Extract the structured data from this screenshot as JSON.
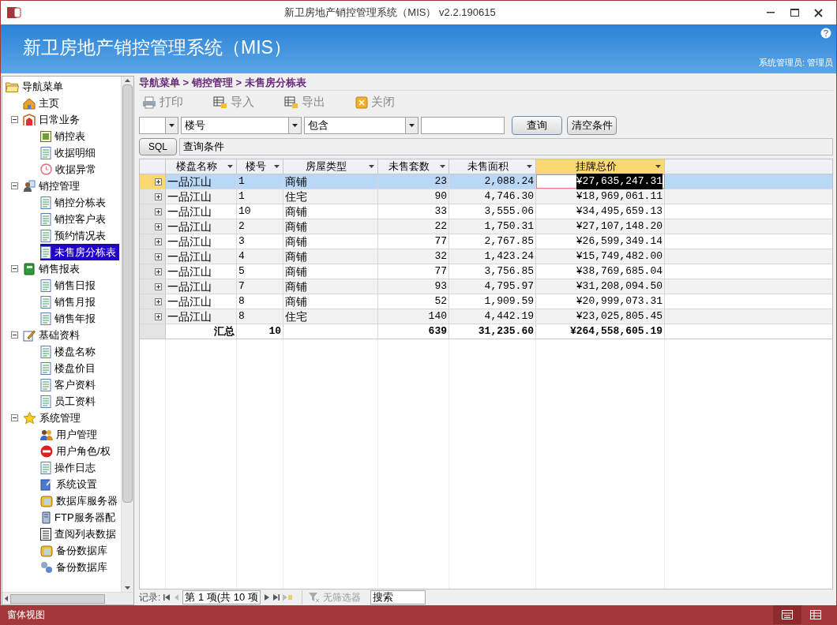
{
  "window": {
    "title": "新卫房地产销控管理系统（MIS） v2.2.190615"
  },
  "banner": {
    "title": "新卫房地产销控管理系统（MIS）",
    "user": "系统管理员: 管理员"
  },
  "nav": {
    "label": "导航菜单",
    "children": [
      {
        "label": "主页",
        "selected": false
      },
      {
        "label": "日常业务",
        "expanded": true,
        "selected": false,
        "children": [
          {
            "label": "销控表",
            "selected": false
          },
          {
            "label": "收据明细",
            "selected": false
          },
          {
            "label": "收据异常",
            "selected": false
          }
        ]
      },
      {
        "label": "销控管理",
        "expanded": true,
        "selected": false,
        "children": [
          {
            "label": "销控分栋表",
            "selected": false
          },
          {
            "label": "销控客户表",
            "selected": false
          },
          {
            "label": "预约情况表",
            "selected": false
          },
          {
            "label": "未售房分栋表",
            "selected": true
          }
        ]
      },
      {
        "label": "销售报表",
        "expanded": true,
        "selected": false,
        "children": [
          {
            "label": "销售日报",
            "selected": false
          },
          {
            "label": "销售月报",
            "selected": false
          },
          {
            "label": "销售年报",
            "selected": false
          }
        ]
      },
      {
        "label": "基础资料",
        "expanded": true,
        "selected": false,
        "children": [
          {
            "label": "楼盘名称",
            "selected": false
          },
          {
            "label": "楼盘价目",
            "selected": false
          },
          {
            "label": "客户资料",
            "selected": false
          },
          {
            "label": "员工资料",
            "selected": false
          }
        ]
      },
      {
        "label": "系统管理",
        "expanded": true,
        "selected": false,
        "children": [
          {
            "label": "用户管理",
            "selected": false
          },
          {
            "label": "用户角色/权",
            "selected": false
          },
          {
            "label": "操作日志",
            "selected": false
          },
          {
            "label": "系统设置",
            "selected": false
          },
          {
            "label": "数据库服务器",
            "selected": false
          },
          {
            "label": "FTP服务器配",
            "selected": false
          },
          {
            "label": "查阅列表数据",
            "selected": false
          },
          {
            "label": "备份数据库",
            "selected": false
          },
          {
            "label": "备份数据库",
            "selected": false
          }
        ]
      }
    ]
  },
  "breadcrumb": "导航菜单 > 销控管理 > 未售房分栋表",
  "toolbar": [
    "打印",
    "导入",
    "导出",
    "关闭"
  ],
  "filter": {
    "field": "楼号",
    "operator": "包含",
    "search_button": "查询",
    "clear_button": "清空条件",
    "sql_button": "SQL",
    "condition": "查询条件"
  },
  "table": {
    "columns": [
      {
        "label": "楼盘名称",
        "numeric": false,
        "selected": false
      },
      {
        "label": "楼号",
        "numeric": false,
        "selected": false
      },
      {
        "label": "房屋类型",
        "numeric": false,
        "selected": false
      },
      {
        "label": "未售套数",
        "numeric": true,
        "selected": false
      },
      {
        "label": "未售面积",
        "numeric": true,
        "selected": false
      },
      {
        "label": "挂牌总价",
        "numeric": true,
        "selected": true
      }
    ],
    "rows": [
      {
        "selected": true,
        "cells": [
          "一品江山",
          "1",
          "商铺",
          "23",
          "2,088.24",
          "¥27,635,247.31"
        ]
      },
      {
        "selected": false,
        "cells": [
          "一品江山",
          "1",
          "住宅",
          "90",
          "4,746.30",
          "¥18,969,061.11"
        ]
      },
      {
        "selected": false,
        "cells": [
          "一品江山",
          "10",
          "商铺",
          "33",
          "3,555.06",
          "¥34,495,659.13"
        ]
      },
      {
        "selected": false,
        "cells": [
          "一品江山",
          "2",
          "商铺",
          "22",
          "1,750.31",
          "¥27,107,148.20"
        ]
      },
      {
        "selected": false,
        "cells": [
          "一品江山",
          "3",
          "商铺",
          "77",
          "2,767.85",
          "¥26,599,349.14"
        ]
      },
      {
        "selected": false,
        "cells": [
          "一品江山",
          "4",
          "商铺",
          "32",
          "1,423.24",
          "¥15,749,482.00"
        ]
      },
      {
        "selected": false,
        "cells": [
          "一品江山",
          "5",
          "商铺",
          "77",
          "3,756.85",
          "¥38,769,685.04"
        ]
      },
      {
        "selected": false,
        "cells": [
          "一品江山",
          "7",
          "商铺",
          "93",
          "4,795.97",
          "¥31,208,094.50"
        ]
      },
      {
        "selected": false,
        "cells": [
          "一品江山",
          "8",
          "商铺",
          "52",
          "1,909.59",
          "¥20,999,073.31"
        ]
      },
      {
        "selected": false,
        "cells": [
          "一品江山",
          "8",
          "住宅",
          "140",
          "4,442.19",
          "¥23,025,805.45"
        ]
      }
    ],
    "totals": {
      "label": "汇总",
      "buildings": "10",
      "units": "639",
      "area": "31,235.60",
      "price": "¥264,558,605.19"
    }
  },
  "record_nav": {
    "label": "记录:",
    "position": "第 1 项(共 10 项",
    "filter": "无筛选器",
    "search": "搜索"
  },
  "status_bar": {
    "view": "窗体视图"
  }
}
